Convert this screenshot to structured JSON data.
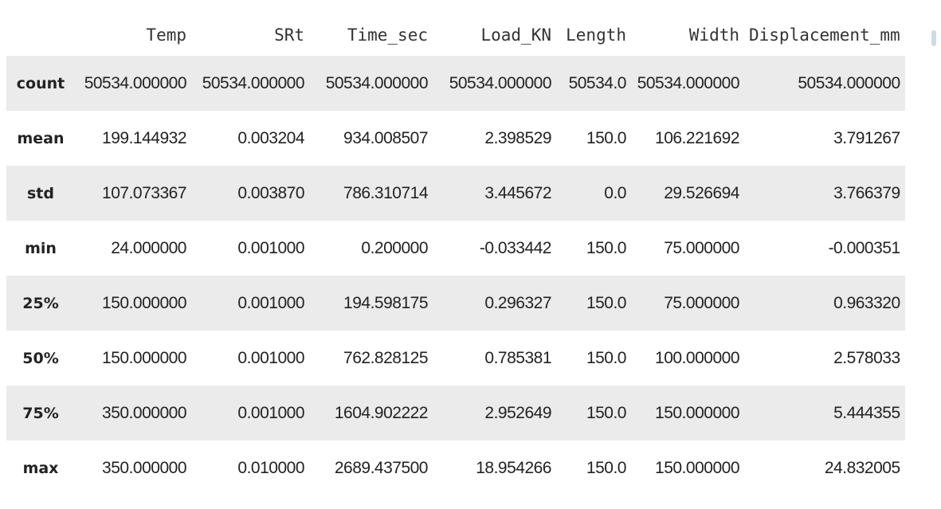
{
  "table": {
    "columns": [
      "",
      "Temp",
      "SRt",
      "Time_sec",
      "Load_KN",
      "Length",
      "Width",
      "Displacement_mm"
    ],
    "rows": [
      {
        "label": "count",
        "values": [
          "50534.000000",
          "50534.000000",
          "50534.000000",
          "50534.000000",
          "50534.0",
          "50534.000000",
          "50534.000000"
        ]
      },
      {
        "label": "mean",
        "values": [
          "199.144932",
          "0.003204",
          "934.008507",
          "2.398529",
          "150.0",
          "106.221692",
          "3.791267"
        ]
      },
      {
        "label": "std",
        "values": [
          "107.073367",
          "0.003870",
          "786.310714",
          "3.445672",
          "0.0",
          "29.526694",
          "3.766379"
        ]
      },
      {
        "label": "min",
        "values": [
          "24.000000",
          "0.001000",
          "0.200000",
          "-0.033442",
          "150.0",
          "75.000000",
          "-0.000351"
        ]
      },
      {
        "label": "25%",
        "values": [
          "150.000000",
          "0.001000",
          "194.598175",
          "0.296327",
          "150.0",
          "75.000000",
          "0.963320"
        ]
      },
      {
        "label": "50%",
        "values": [
          "150.000000",
          "0.001000",
          "762.828125",
          "0.785381",
          "150.0",
          "100.000000",
          "2.578033"
        ]
      },
      {
        "label": "75%",
        "values": [
          "350.000000",
          "0.001000",
          "1604.902222",
          "2.952649",
          "150.0",
          "150.000000",
          "5.444355"
        ]
      },
      {
        "label": "max",
        "values": [
          "350.000000",
          "0.010000",
          "2689.437500",
          "18.954266",
          "150.0",
          "150.000000",
          "24.832005"
        ]
      }
    ]
  }
}
